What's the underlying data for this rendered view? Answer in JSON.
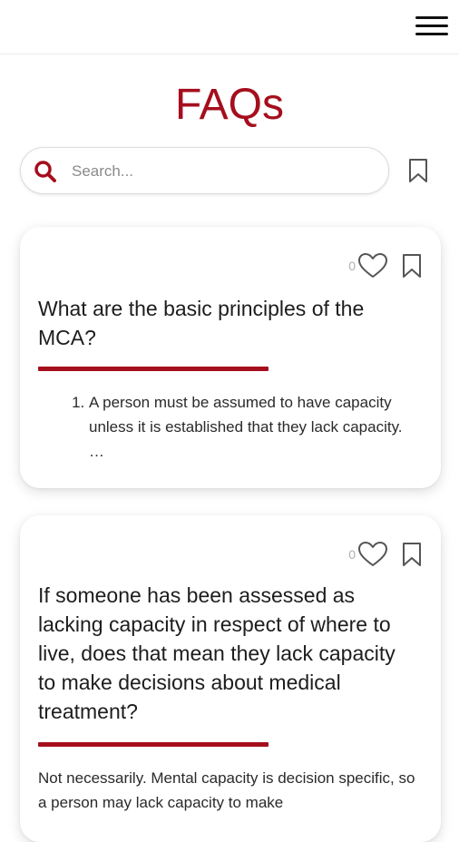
{
  "header": {
    "menu_icon": "hamburger-menu-icon"
  },
  "page": {
    "title": "FAQs"
  },
  "search": {
    "placeholder": "Search...",
    "value": "",
    "icon": "search-icon",
    "saved_filter_icon": "bookmark-outline-icon"
  },
  "colors": {
    "accent": "#a50e1d",
    "text": "#1d1d1d",
    "muted": "#8a8a8a"
  },
  "faqs": [
    {
      "likes": "0",
      "question": "What are the basic principles of the MCA?",
      "answer_list": [
        "A person must be assumed to have capacity unless it is established that they lack capacity. …"
      ]
    },
    {
      "likes": "0",
      "question": "If someone has been assessed as lacking capacity in respect of where to live, does that mean they lack capacity to make decisions about medical treatment?",
      "answer": "Not necessarily. Mental capacity is decision specific, so a person may lack capacity to make"
    }
  ]
}
